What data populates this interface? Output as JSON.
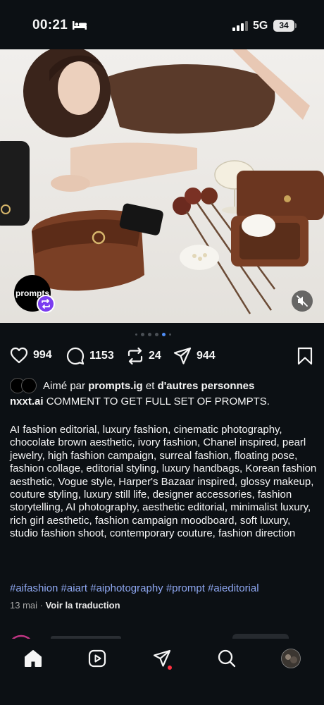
{
  "status_bar": {
    "time": "00:21",
    "network": "5G",
    "battery": "34"
  },
  "post": {
    "image_logo_text": "prompts",
    "carousel": {
      "count": 6,
      "active_index": 4
    },
    "likes": "994",
    "comments": "1153",
    "reposts": "24",
    "shares": "944",
    "liked_by": {
      "prefix": "Aimé par ",
      "user": "prompts.ig",
      "middle": " et ",
      "others": "d'autres personnes"
    },
    "author": "nxxt.ai",
    "caption_head": " COMMENT TO GET FULL SET OF PROMPTS.",
    "caption_body": "AI fashion editorial, luxury fashion, cinematic photography, chocolate brown aesthetic, ivory fashion, Chanel inspired, pearl jewelry, high fashion campaign, surreal fashion, floating pose, fashion collage, editorial styling, luxury handbags, Korean fashion aesthetic, Vogue style, Harper's Bazaar inspired, glossy makeup, couture styling, luxury still life, designer accessories, fashion storytelling, AI photography, aesthetic editorial, minimalist luxury, rich girl aesthetic, fashion campaign moodboard, soft luxury, studio fashion shoot, contemporary couture, fashion direction",
    "hashtags": "#aifashion #aiart #aiphotography #prompt #aieditorial",
    "date": "13 mai",
    "separator": " · ",
    "translate": "Voir la traduction"
  },
  "colors": {
    "background": "#0c1014",
    "hashtag": "#8fa8f2",
    "active_dot": "#4f8ef7",
    "notification": "#ff3040",
    "repost_badge": "#7b3cf0"
  },
  "nav": {
    "items": [
      "home-icon",
      "reels-icon",
      "direct-icon",
      "search-icon",
      "profile-avatar"
    ]
  }
}
